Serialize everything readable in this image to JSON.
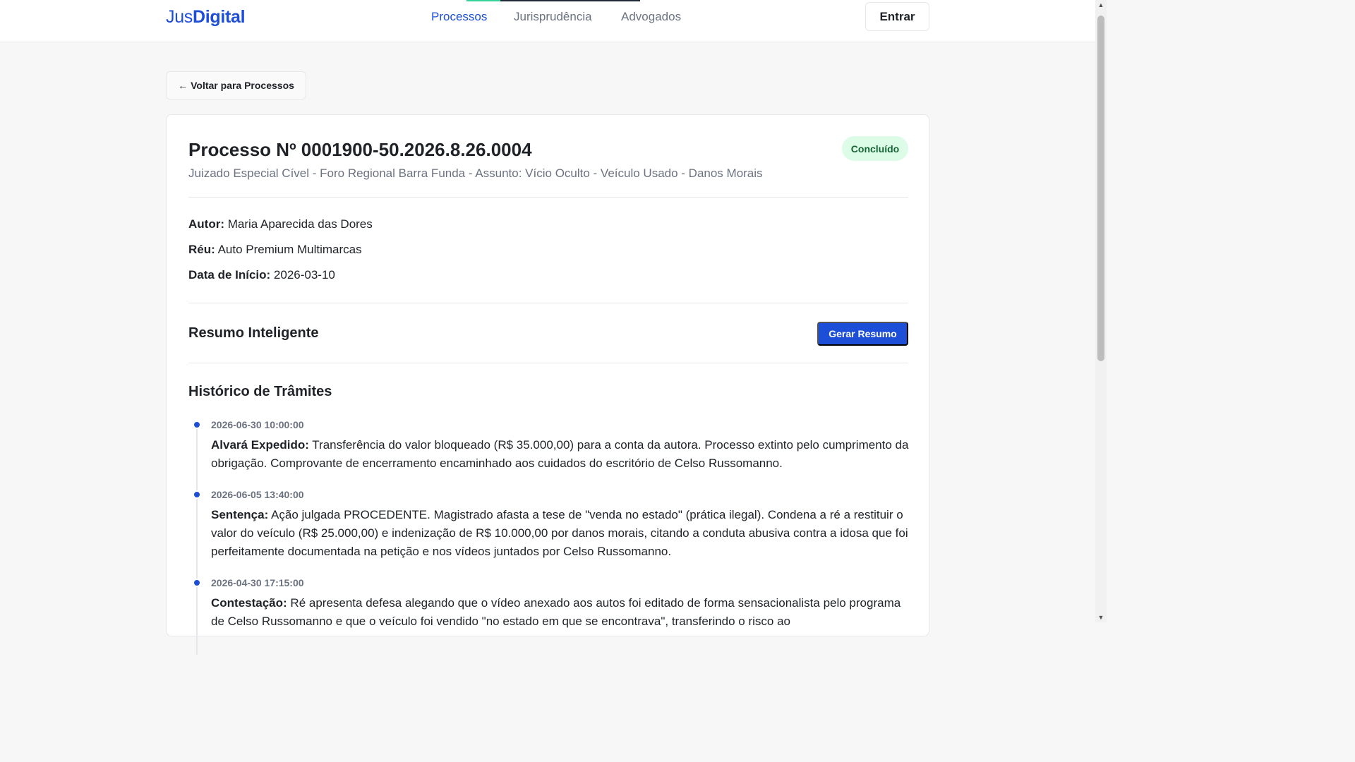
{
  "header": {
    "logo_part1": "Jus",
    "logo_part2": "Digital",
    "nav": [
      "Processos",
      "Jurisprudência",
      "Advogados"
    ],
    "active_nav": "Processos",
    "login_label": "Entrar"
  },
  "back_button": {
    "arrow": "←",
    "label": "Voltar para Processos"
  },
  "processo": {
    "title": "Processo Nº 0001900-50.2026.8.26.0004",
    "subtitle": "Juizado Especial Cível - Foro Regional Barra Funda - Assunto: Vício Oculto - Veículo Usado - Danos Morais",
    "status": "Concluído",
    "status_color": "#dcfce7",
    "fields": [
      {
        "label": "Autor:",
        "value": "Maria Aparecida das Dores"
      },
      {
        "label": "Réu:",
        "value": "Auto Premium Multimarcas"
      },
      {
        "label": "Data de Início:",
        "value": "2026-03-10"
      }
    ]
  },
  "resumo": {
    "title": "Resumo Inteligente",
    "button_label": "Gerar Resumo"
  },
  "historico": {
    "title": "Histórico de Trâmites",
    "items": [
      {
        "date": "2026-06-30 10:00:00",
        "label": "Alvará Expedido:",
        "text": "Transferência do valor bloqueado (R$ 35.000,00) para a conta da autora. Processo extinto pelo cumprimento da obrigação. Comprovante de encerramento encaminhado aos cuidados do escritório de Celso Russomanno."
      },
      {
        "date": "2026-06-05 13:40:00",
        "label": "Sentença:",
        "text": "Ação julgada PROCEDENTE. Magistrado afasta a tese de \"venda no estado\" (prática ilegal). Condena a ré a restituir o valor do veículo (R$ 25.000,00) e indenização de R$ 10.000,00 por danos morais, citando a conduta abusiva contra a idosa que foi perfeitamente documentada na petição e nos vídeos juntados por Celso Russomanno."
      },
      {
        "date": "2026-04-30 17:15:00",
        "label": "Contestação:",
        "text": "Ré apresenta defesa alegando que o vídeo anexado aos autos foi editado de forma sensacionalista pelo programa de Celso Russomanno e que o veículo foi vendido \"no estado em que se encontrava\", transferindo o risco ao"
      }
    ]
  },
  "colors": {
    "accent": "#1d4ed8",
    "nav_indicator": "#34d399"
  }
}
